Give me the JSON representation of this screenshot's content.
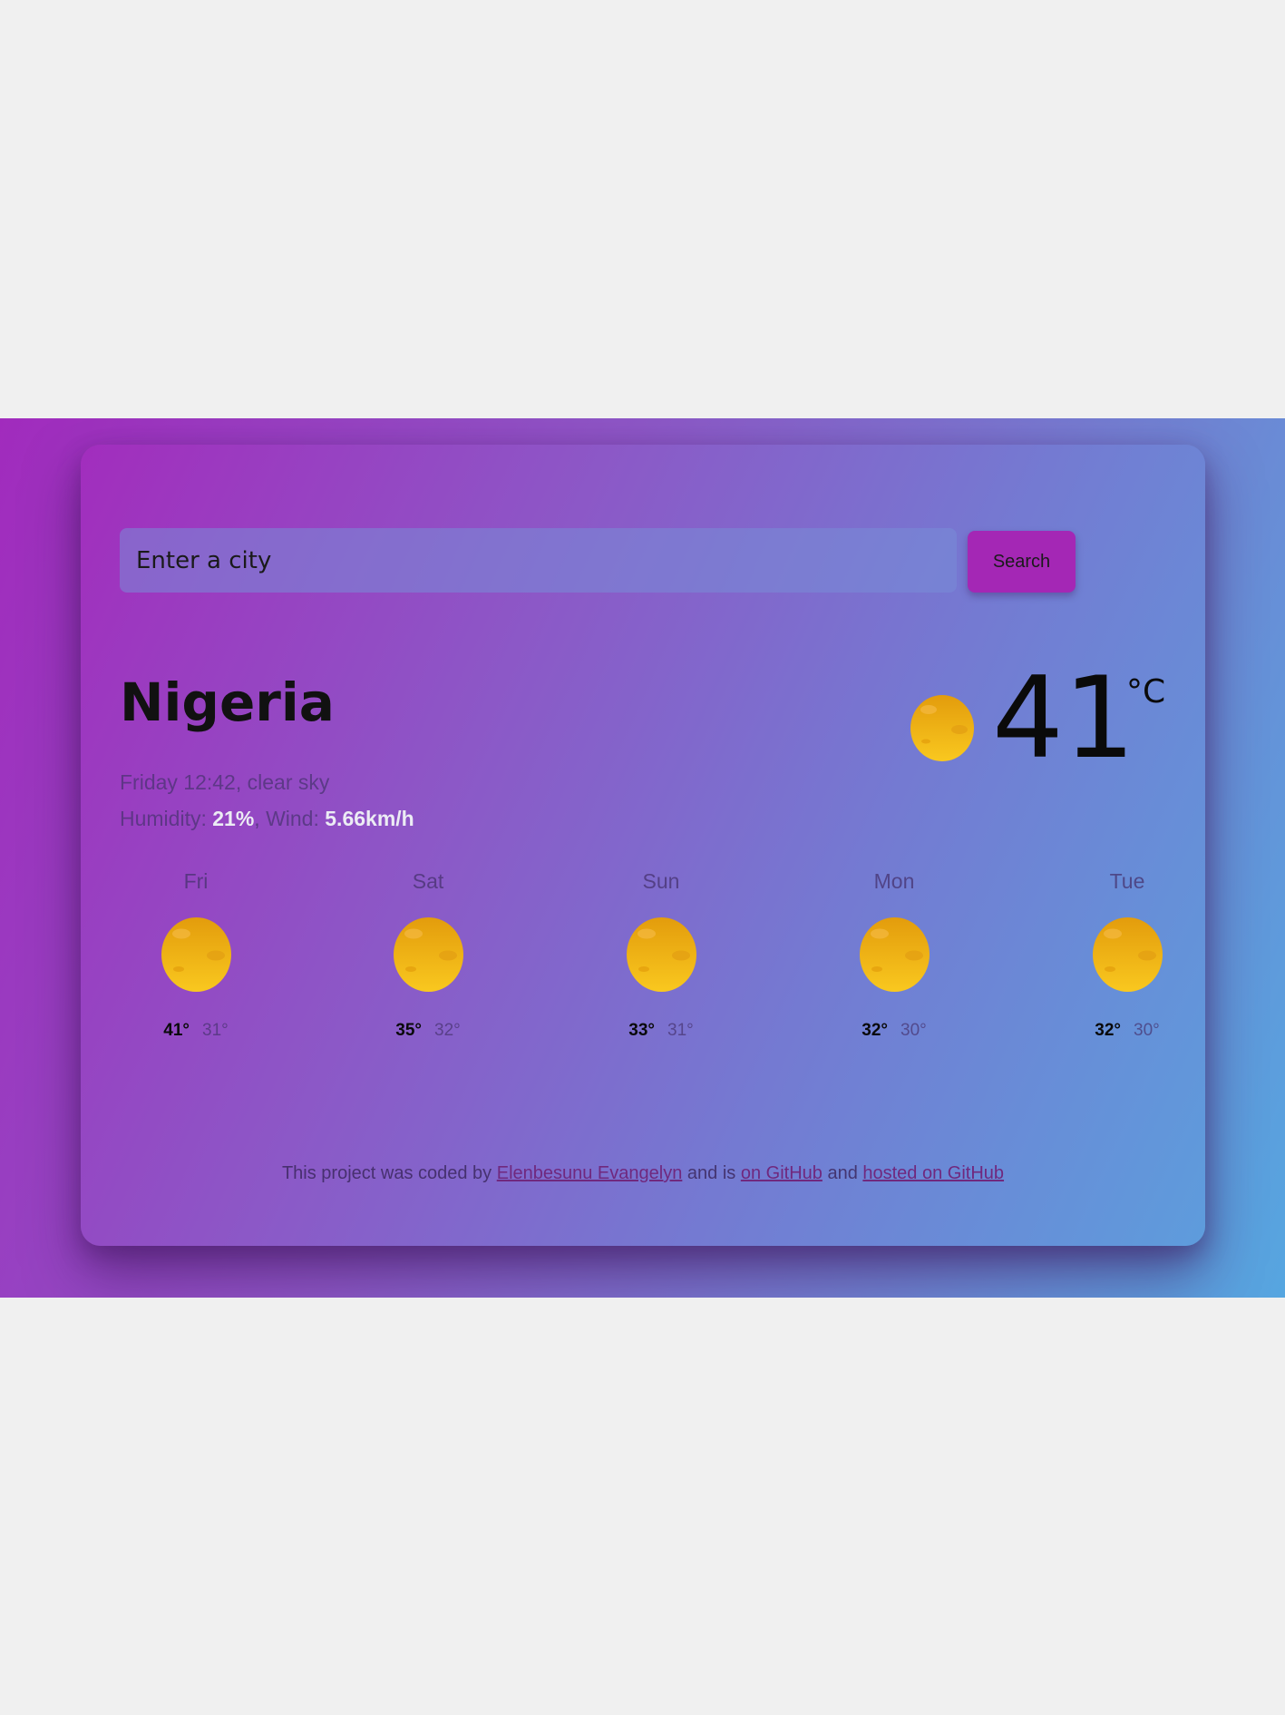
{
  "search": {
    "placeholder": "Enter a city",
    "button_label": "Search"
  },
  "current": {
    "city": "Nigeria",
    "datetime_description": "Friday 12:42, clear sky",
    "humidity_label": "Humidity: ",
    "humidity_value": "21%",
    "wind_label": ", Wind: ",
    "wind_value": "5.66km/h",
    "temperature": "41",
    "unit": "°C",
    "icon": "sun-icon"
  },
  "forecast": [
    {
      "day": "Fri",
      "max": "41°",
      "min": "31°",
      "icon": "sun-icon"
    },
    {
      "day": "Sat",
      "max": "35°",
      "min": "32°",
      "icon": "sun-icon"
    },
    {
      "day": "Sun",
      "max": "33°",
      "min": "31°",
      "icon": "sun-icon"
    },
    {
      "day": "Mon",
      "max": "32°",
      "min": "30°",
      "icon": "sun-icon"
    },
    {
      "day": "Tue",
      "max": "32°",
      "min": "30°",
      "icon": "sun-icon"
    }
  ],
  "footer": {
    "text_1": "This project was coded by ",
    "author_link": "Elenbesunu Evangelyn",
    "text_2": " and is ",
    "github_link": "on GitHub",
    "text_3": " and ",
    "hosted_link": "hosted on GitHub"
  },
  "colors": {
    "accent_button": "#a427b5",
    "sun_light": "#f7c51c",
    "sun_dark": "#e39c0c"
  }
}
